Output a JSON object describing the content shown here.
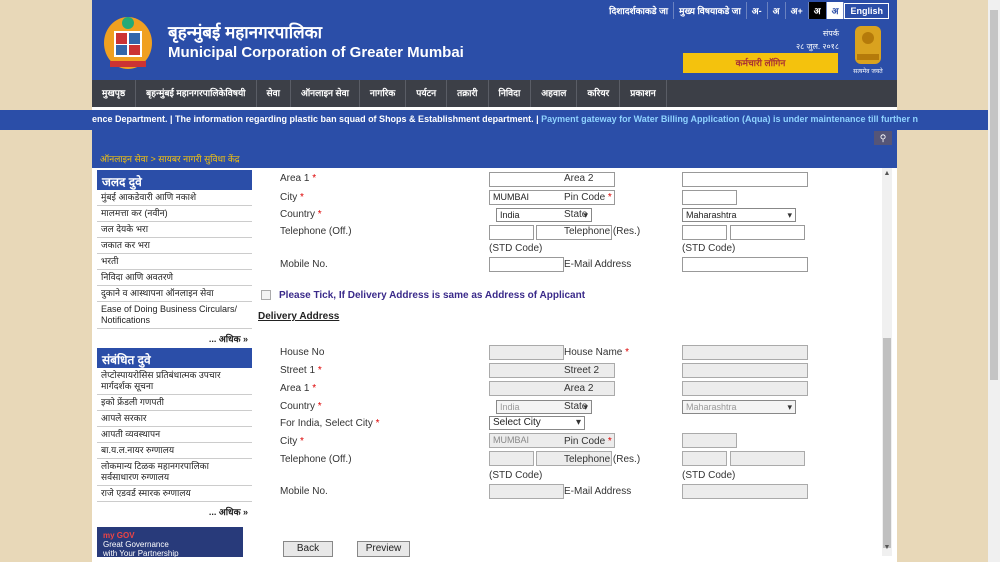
{
  "header": {
    "title_marathi": "बृहन्मुंबई महानगरपालिका",
    "title_english": "Municipal Corporation of Greater Mumbai",
    "top_links": [
      "दिशादर्शकाकडे जा",
      "मुख्य विषयाकडे जा",
      "अ-",
      "अ",
      "अ+",
      "अ",
      "अ",
      "English"
    ],
    "sampark_label": "संपर्क",
    "date": "२८ जुल. २०१८",
    "emblem_caption": "सत्यमेव जयते",
    "employee_login": "कर्मचारी लॉगिन"
  },
  "nav": [
    "मुखपृष्ठ",
    "बृहन्मुंबई महानगरपालिकेविषयी",
    "सेवा",
    "ऑनलाइन सेवा",
    "नागरिक",
    "पर्यटन",
    "तक्रारी",
    "निविदा",
    "अहवाल",
    "करियर",
    "प्रकाशन"
  ],
  "ticker": {
    "text1": "ence Department.  |  The information regarding plastic ban squad of Shops & Establishment department.  |",
    "text2": " Payment gateway for Water Billing Application (Aqua) is under maintenance till further n"
  },
  "breadcrumb": "ऑनलाइन सेवा  >  सायबर नागरी सुविधा केंद्र",
  "sidebar": {
    "quick_title": "जलद दुवे",
    "quick_items": [
      "मुंबई आकडेवारी आणि नकाशे",
      "मालमत्ता कर (नवीन)",
      "जल देयके भरा",
      "जकात कर भरा",
      "भरती",
      "निविदा आणि अवतरणे",
      "दुकाने व आस्थापना ऑनलाइन सेवा",
      "Ease of Doing Business Circulars/ Notifications"
    ],
    "more": "... अधिक »",
    "related_title": "संबंधित दुवे",
    "related_items": [
      "लेप्टोस्पायरोसिस प्रतिबंधात्मक उपचार मार्गदर्शक सूचना",
      "इको फ्रेंडली गणपती",
      "आपले सरकार",
      "आपती व्यवस्थापन",
      "बा.य.ल.नायर रुग्णालय",
      "लोकमान्य टिळक महानगरपालिका सर्वसाधारण रुग्णालय",
      "राजे एडवर्ड स्मारक रुग्णालय"
    ],
    "more2": "... अधिक »",
    "mygov_logo": "my GOV",
    "mygov_text1": "Great Governance",
    "mygov_text2": "with Your Partnership"
  },
  "applicant": {
    "area1": "Area 1",
    "area2": "Area 2",
    "city": "City",
    "city_value": "MUMBAI",
    "pin": "Pin Code",
    "country": "Country",
    "country_value": "India",
    "state": "State",
    "state_value": "Maharashtra",
    "tel_off": "Telephone (Off.)",
    "tel_res": "Telephone (Res.)",
    "std": "(STD Code)",
    "mobile": "Mobile No.",
    "email": "E-Mail Address"
  },
  "tick_label": "Please Tick, If Delivery Address is same as Address of Applicant",
  "delivery": {
    "section": "Delivery Address",
    "house_no": "House No",
    "house_name": "House Name",
    "street1": "Street 1",
    "street2": "Street 2",
    "area1": "Area 1",
    "area2": "Area 2",
    "country": "Country",
    "country_value": "India",
    "state": "State",
    "state_value": "Maharashtra",
    "for_india": "For India, Select City",
    "select_city": "Select City",
    "city": "City",
    "city_value": "MUMBAI",
    "pin": "Pin Code",
    "tel_off": "Telephone (Off.)",
    "tel_res": "Telephone (Res.)",
    "std": "(STD Code)",
    "mobile": "Mobile No.",
    "email": "E-Mail Address"
  },
  "buttons": {
    "back": "Back",
    "preview": "Preview"
  }
}
